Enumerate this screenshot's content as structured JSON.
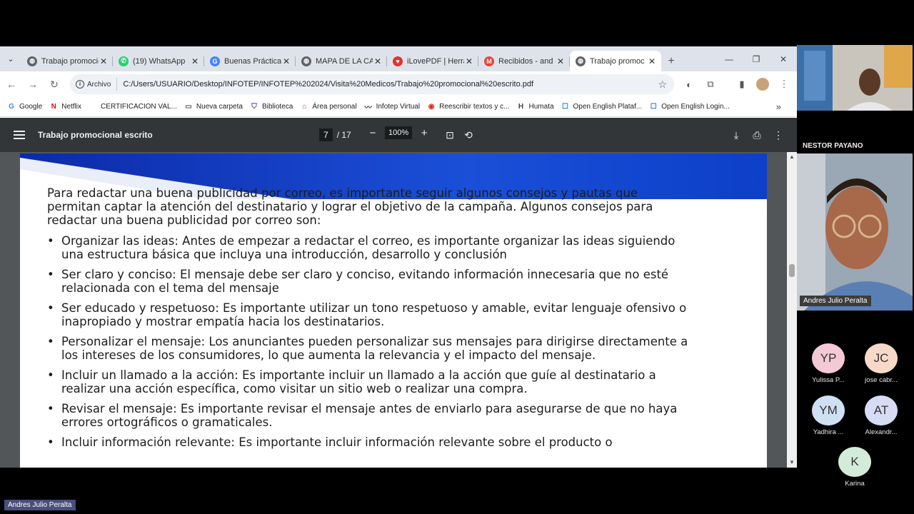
{
  "browser": {
    "tabs": [
      {
        "title": "Trabajo promocional",
        "favicon": "globe",
        "color": "#5f6368",
        "active": false
      },
      {
        "title": "(19) WhatsApp",
        "favicon": "whatsapp",
        "color": "#25d366",
        "active": false
      },
      {
        "title": "Buenas Prácticas",
        "favicon": "google",
        "color": "#4285f4",
        "active": false
      },
      {
        "title": "MAPA DE LA CA",
        "favicon": "globe",
        "color": "#5f6368",
        "active": false
      },
      {
        "title": "iLovePDF | Herra",
        "favicon": "heart",
        "color": "#e5322d",
        "active": false
      },
      {
        "title": "Recibidos - and",
        "favicon": "gmail",
        "color": "#ea4335",
        "active": false
      },
      {
        "title": "Trabajo promoc",
        "favicon": "globe",
        "color": "#5f6368",
        "active": true
      }
    ],
    "address": {
      "chip_label": "Archivo",
      "url": "C:/Users/USUARIO/Desktop/INFOTEP/INFOTEP%202024/Visita%20Medicos/Trabajo%20promocional%20escrito.pdf"
    },
    "bookmarks": [
      {
        "label": "Google",
        "icon": "G",
        "color": "#4285f4"
      },
      {
        "label": "Netflix",
        "icon": "N",
        "color": "#e50914"
      },
      {
        "label": "CERTIFICACION VAL...",
        "icon": "",
        "color": "#888888"
      },
      {
        "label": "Nueva carpeta",
        "icon": "folder",
        "color": "#555555"
      },
      {
        "label": "Biblioteca",
        "icon": "shield",
        "color": "#5a3e9b"
      },
      {
        "label": "Área personal",
        "icon": "cap",
        "color": "#c0392b"
      },
      {
        "label": "Infotep Virtual",
        "icon": "wave",
        "color": "#333333"
      },
      {
        "label": "Reescribir textos y c...",
        "icon": "car",
        "color": "#d93025"
      },
      {
        "label": "Humata",
        "icon": "H",
        "color": "#444444"
      },
      {
        "label": "Open English Plataf...",
        "icon": "doc",
        "color": "#1a73e8"
      },
      {
        "label": "Open English Login...",
        "icon": "doc",
        "color": "#1a73e8"
      }
    ]
  },
  "pdf": {
    "title": "Trabajo promocional escrito",
    "current_page": "7",
    "total_pages": "/ 17",
    "zoom": "100%",
    "intro": "Para redactar una buena publicidad por correo, es importante seguir algunos consejos y pautas que permitan captar la atención del destinatario y lograr el objetivo de la campaña. Algunos consejos para redactar una buena publicidad por correo son:",
    "bullets": [
      "Organizar las ideas: Antes de empezar a redactar el correo, es importante organizar las ideas siguiendo una estructura básica que incluya una introducción, desarrollo y conclusión",
      "Ser claro y conciso: El mensaje debe ser claro y conciso, evitando información innecesaria que no esté relacionada con el tema del mensaje",
      "Ser educado y respetuoso: Es importante utilizar un tono respetuoso y amable, evitar lenguaje ofensivo o inapropiado y mostrar empatía hacia los destinatarios.",
      "Personalizar el mensaje: Los anunciantes pueden personalizar sus mensajes para dirigirse directamente a los intereses de los consumidores, lo que aumenta la relevancia y el impacto del mensaje.",
      "Incluir un llamado a la acción: Es importante incluir un llamado a la acción que guíe al destinatario a realizar una acción específica, como visitar un sitio web o realizar una compra.",
      "Revisar el mensaje: Es importante revisar el mensaje antes de enviarlo para asegurarse de que no haya errores ortográficos o gramaticales.",
      "Incluir información relevante: Es importante incluir información relevante sobre el producto o"
    ]
  },
  "meeting": {
    "participant_top_label": "NESTOR PAYANO",
    "main_speaker": "Andres Julio Peralta",
    "presenter_chip": "Andres Julio Peralta",
    "attendees": [
      {
        "initials": "YP",
        "name": "Yulissa P...",
        "color": "#f4c9d6"
      },
      {
        "initials": "JC",
        "name": "jose cabr...",
        "color": "#f7d9c9"
      },
      {
        "initials": "YM",
        "name": "Yadhira ...",
        "color": "#cfe0f4"
      },
      {
        "initials": "AT",
        "name": "Alexandr...",
        "color": "#d6dcf4"
      },
      {
        "initials": "K",
        "name": "Karina",
        "color": "#d3ecd9"
      }
    ]
  }
}
